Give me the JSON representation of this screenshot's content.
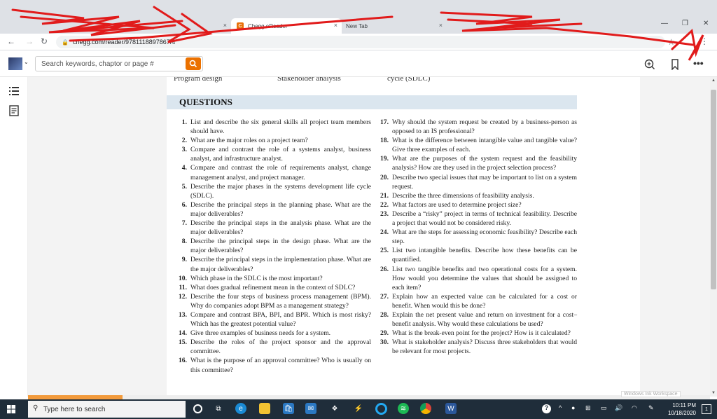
{
  "browser": {
    "tabs": [
      {
        "label": "Chegg eReader",
        "active": true
      },
      {
        "label": "New Tab",
        "active": false
      }
    ],
    "tab_close": "×",
    "url": "chegg.com/reader/9781118897867/4",
    "win_min": "—",
    "win_max": "❐",
    "win_close": "✕"
  },
  "reader": {
    "search_placeholder": "Search keywords, chaptor or page #"
  },
  "page": {
    "prev_titles": [
      "Program design",
      "Stakeholder analysis",
      "cycle (SDLC)"
    ],
    "section_title": "QUESTIONS",
    "questions_left": [
      {
        "num": "1.",
        "text": "List and describe the six general skills all project team members should have."
      },
      {
        "num": "2.",
        "text": "What are the major roles on a project team?"
      },
      {
        "num": "3.",
        "text": "Compare and contrast the role of a systems analyst, business analyst, and infrastructure analyst."
      },
      {
        "num": "4.",
        "text": "Compare and contrast the role of requirements analyst, change management analyst, and project manager."
      },
      {
        "num": "5.",
        "text": "Describe the major phases in the systems development life cycle (SDLC)."
      },
      {
        "num": "6.",
        "text": "Describe the principal steps in the planning phase. What are the major deliverables?"
      },
      {
        "num": "7.",
        "text": "Describe the principal steps in the analysis phase. What are the major deliverables?"
      },
      {
        "num": "8.",
        "text": "Describe the principal steps in the design phase. What are the major deliverables?"
      },
      {
        "num": "9.",
        "text": "Describe the principal steps in the implementation phase. What are the major deliverables?"
      },
      {
        "num": "10.",
        "text": "Which phase in the SDLC is the most important?"
      },
      {
        "num": "11.",
        "text": "What does gradual refinement mean in the context of SDLC?"
      },
      {
        "num": "12.",
        "text": "Describe the four steps of business process management (BPM). Why do companies adopt BPM as a management strategy?"
      },
      {
        "num": "13.",
        "text": "Compare and contrast BPA, BPI, and BPR. Which is most risky? Which has the greatest potential value?"
      },
      {
        "num": "14.",
        "text": "Give three examples of business needs for a system."
      },
      {
        "num": "15.",
        "text": "Describe the roles of the project sponsor and the approval committee."
      },
      {
        "num": "16.",
        "text": "What is the purpose of an approval committee? Who is usually on this committee?"
      }
    ],
    "questions_right": [
      {
        "num": "17.",
        "text": "Why should the system request be created by a business-person as opposed to an IS professional?"
      },
      {
        "num": "18.",
        "text": "What is the difference between intangible value and tangible value? Give three examples of each."
      },
      {
        "num": "19.",
        "text": "What are the purposes of the system request and the feasibility analysis? How are they used in the project selection process?"
      },
      {
        "num": "20.",
        "text": "Describe two special issues that may be important to list on a system request."
      },
      {
        "num": "21.",
        "text": "Describe the three dimensions of feasibility analysis."
      },
      {
        "num": "22.",
        "text": "What factors are used to determine project size?"
      },
      {
        "num": "23.",
        "text": "Describe a “risky” project in terms of technical feasibility. Describe a project that would not be considered risky."
      },
      {
        "num": "24.",
        "text": "What are the steps for assessing economic feasibility? Describe each step."
      },
      {
        "num": "25.",
        "text": "List two intangible benefits. Describe how these benefits can be quantified."
      },
      {
        "num": "26.",
        "text": "List two tangible benefits and two operational costs for a system. How would you determine the values that should be assigned to each item?"
      },
      {
        "num": "27.",
        "text": "Explain how an expected value can be calculated for a cost or benefit. When would this be done?"
      },
      {
        "num": "28.",
        "text": "Explain the net present value and return on investment for a cost–benefit analysis. Why would these calculations be used?"
      },
      {
        "num": "29.",
        "text": "What is the break-even point for the project? How is it calculated?"
      },
      {
        "num": "30.",
        "text": "What is stakeholder analysis? Discuss three stakeholders that would be relevant for most projects."
      }
    ],
    "watermark": "Windows Ink Workspace"
  },
  "taskbar": {
    "search_label": "Type here to search",
    "time": "10:11 PM",
    "date": "10/18/2020",
    "notif_count": "1"
  },
  "colors": {
    "accent": "#eb7100",
    "question_header_bg": "#dbe6ef",
    "scribble": "#e11b1b",
    "taskbar": "#1f2d3a"
  }
}
